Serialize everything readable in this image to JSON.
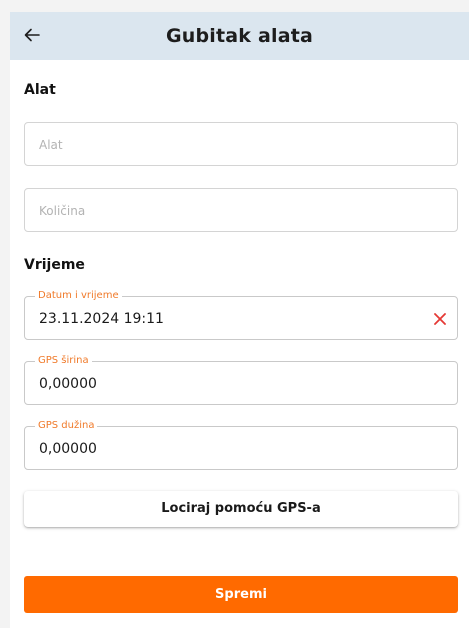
{
  "header": {
    "title": "Gubitak alata",
    "back_icon": "arrow-left-icon"
  },
  "sections": {
    "tool_label": "Alat",
    "time_label": "Vrijeme"
  },
  "fields": {
    "tool": {
      "placeholder": "Alat",
      "value": ""
    },
    "quantity": {
      "placeholder": "Količina",
      "value": ""
    },
    "datetime": {
      "label": "Datum i vrijeme",
      "value": "23.11.2024 19:11",
      "clear_icon": "close-icon"
    },
    "gps_lat": {
      "label": "GPS širina",
      "value": "0,00000"
    },
    "gps_lon": {
      "label": "GPS dužina",
      "value": "0,00000"
    }
  },
  "buttons": {
    "locate_label": "Lociraj pomoću GPS-a",
    "save_label": "Spremi"
  },
  "colors": {
    "accent": "#ff6a00",
    "floating_label": "#f07a2a",
    "clear_icon": "#e53935",
    "header_bg": "#dbe6ef"
  }
}
